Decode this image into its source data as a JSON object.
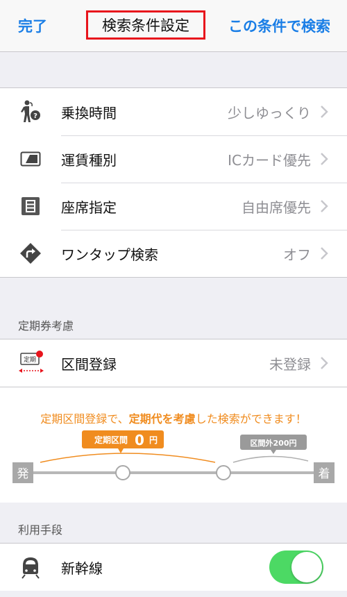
{
  "nav": {
    "done_label": "完了",
    "title": "検索条件設定",
    "search_label": "この条件で検索"
  },
  "settings": {
    "items": [
      {
        "label": "乗換時間",
        "value": "少しゆっくり",
        "icon": "walking-person-question-icon"
      },
      {
        "label": "運賃種別",
        "value": "ICカード優先",
        "icon": "ic-card-icon"
      },
      {
        "label": "座席指定",
        "value": "自由席優先",
        "icon": "seat-icon"
      },
      {
        "label": "ワンタップ検索",
        "value": "オフ",
        "icon": "turn-right-sign-icon"
      }
    ]
  },
  "commuter": {
    "header": "定期券考慮",
    "label": "区間登録",
    "value": "未登録",
    "icon_text": "定期"
  },
  "promo": {
    "text_1": "定期区間登録で、",
    "text_bold": "定期代を考慮",
    "text_2": "した検索ができます！",
    "badge_commuter_prefix": "定期区間",
    "badge_commuter_amount": "0",
    "badge_commuter_unit": "円",
    "badge_outside": "区間外200円",
    "start_label": "発",
    "end_label": "着"
  },
  "means": {
    "header": "利用手段",
    "items": [
      {
        "label": "新幹線",
        "enabled": true,
        "icon": "shinkansen-icon"
      }
    ]
  },
  "colors": {
    "accent": "#1a7ee6",
    "highlight_border": "#e8141c",
    "promo_orange": "#f08c1f",
    "toggle_on": "#4cd964"
  }
}
